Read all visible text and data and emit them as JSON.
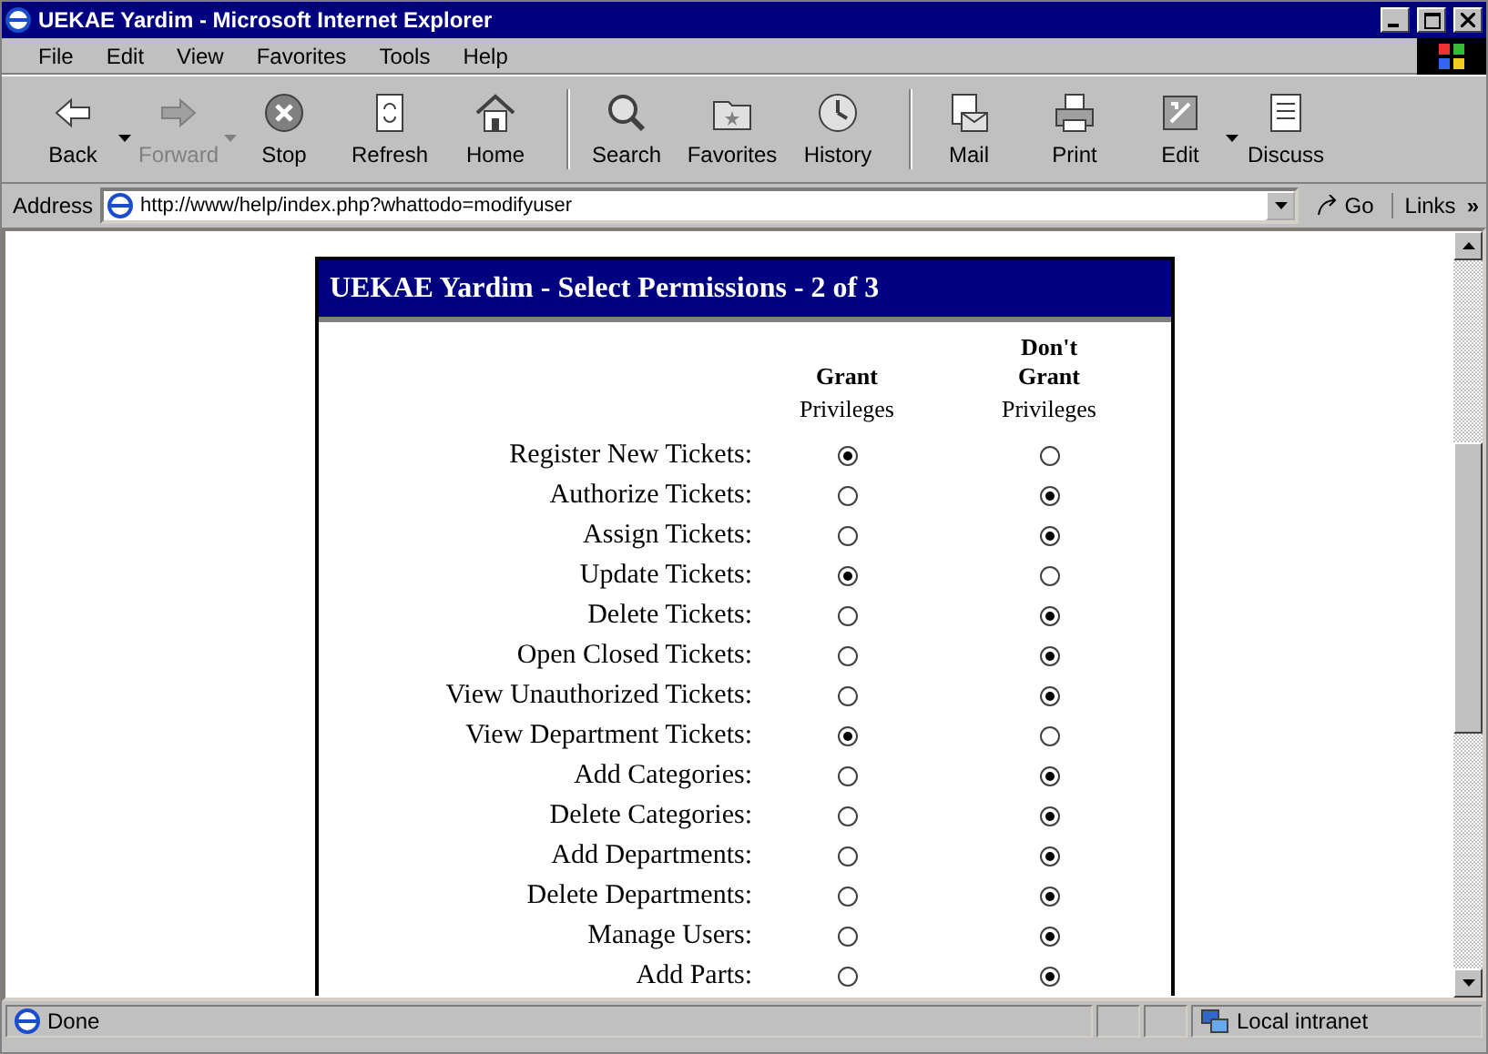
{
  "window": {
    "title": "UEKAE Yardim - Microsoft Internet Explorer"
  },
  "menu": [
    {
      "label": "File"
    },
    {
      "label": "Edit"
    },
    {
      "label": "View"
    },
    {
      "label": "Favorites"
    },
    {
      "label": "Tools"
    },
    {
      "label": "Help"
    }
  ],
  "toolbar": [
    {
      "kind": "back",
      "label": "Back",
      "disabled": false,
      "dropdown": true
    },
    {
      "kind": "forward",
      "label": "Forward",
      "disabled": true,
      "dropdown": true
    },
    {
      "kind": "stop",
      "label": "Stop",
      "disabled": false,
      "dropdown": false
    },
    {
      "kind": "refresh",
      "label": "Refresh",
      "disabled": false,
      "dropdown": false
    },
    {
      "kind": "home",
      "label": "Home",
      "disabled": false,
      "dropdown": false
    },
    {
      "kind": "sep"
    },
    {
      "kind": "search",
      "label": "Search",
      "disabled": false,
      "dropdown": false
    },
    {
      "kind": "favorites",
      "label": "Favorites",
      "disabled": false,
      "dropdown": false
    },
    {
      "kind": "history",
      "label": "History",
      "disabled": false,
      "dropdown": false
    },
    {
      "kind": "sep"
    },
    {
      "kind": "mail",
      "label": "Mail",
      "disabled": false,
      "dropdown": false
    },
    {
      "kind": "print",
      "label": "Print",
      "disabled": false,
      "dropdown": false
    },
    {
      "kind": "edit",
      "label": "Edit",
      "disabled": false,
      "dropdown": true
    },
    {
      "kind": "discuss",
      "label": "Discuss",
      "disabled": false,
      "dropdown": false
    }
  ],
  "address": {
    "label": "Address",
    "url": "http://www/help/index.php?whattodo=modifyuser",
    "go": "Go",
    "links": "Links",
    "more": "»"
  },
  "panel": {
    "title": "UEKAE Yardim - Select Permissions - 2 of 3",
    "columns": [
      {
        "bold": "Grant",
        "text": "Privileges"
      },
      {
        "bold": "Don't Grant",
        "text": "Privileges"
      }
    ],
    "rows": [
      {
        "label": "Register New Tickets:",
        "options": [
          {
            "selected": true
          },
          {
            "selected": false
          }
        ]
      },
      {
        "label": "Authorize Tickets:",
        "options": [
          {
            "selected": false
          },
          {
            "selected": true
          }
        ]
      },
      {
        "label": "Assign Tickets:",
        "options": [
          {
            "selected": false
          },
          {
            "selected": true
          }
        ]
      },
      {
        "label": "Update Tickets:",
        "options": [
          {
            "selected": true
          },
          {
            "selected": false
          }
        ]
      },
      {
        "label": "Delete Tickets:",
        "options": [
          {
            "selected": false
          },
          {
            "selected": true
          }
        ]
      },
      {
        "label": "Open Closed Tickets:",
        "options": [
          {
            "selected": false
          },
          {
            "selected": true
          }
        ]
      },
      {
        "label": "View Unauthorized Tickets:",
        "options": [
          {
            "selected": false
          },
          {
            "selected": true
          }
        ]
      },
      {
        "label": "View Department Tickets:",
        "options": [
          {
            "selected": true
          },
          {
            "selected": false
          }
        ]
      },
      {
        "label": "Add Categories:",
        "options": [
          {
            "selected": false
          },
          {
            "selected": true
          }
        ]
      },
      {
        "label": "Delete Categories:",
        "options": [
          {
            "selected": false
          },
          {
            "selected": true
          }
        ]
      },
      {
        "label": "Add Departments:",
        "options": [
          {
            "selected": false
          },
          {
            "selected": true
          }
        ]
      },
      {
        "label": "Delete Departments:",
        "options": [
          {
            "selected": false
          },
          {
            "selected": true
          }
        ]
      },
      {
        "label": "Manage Users:",
        "options": [
          {
            "selected": false
          },
          {
            "selected": true
          }
        ]
      },
      {
        "label": "Add Parts:",
        "options": [
          {
            "selected": false
          },
          {
            "selected": true
          }
        ]
      }
    ]
  },
  "status_bar": {
    "text": "Done",
    "zone": "Local intranet"
  }
}
